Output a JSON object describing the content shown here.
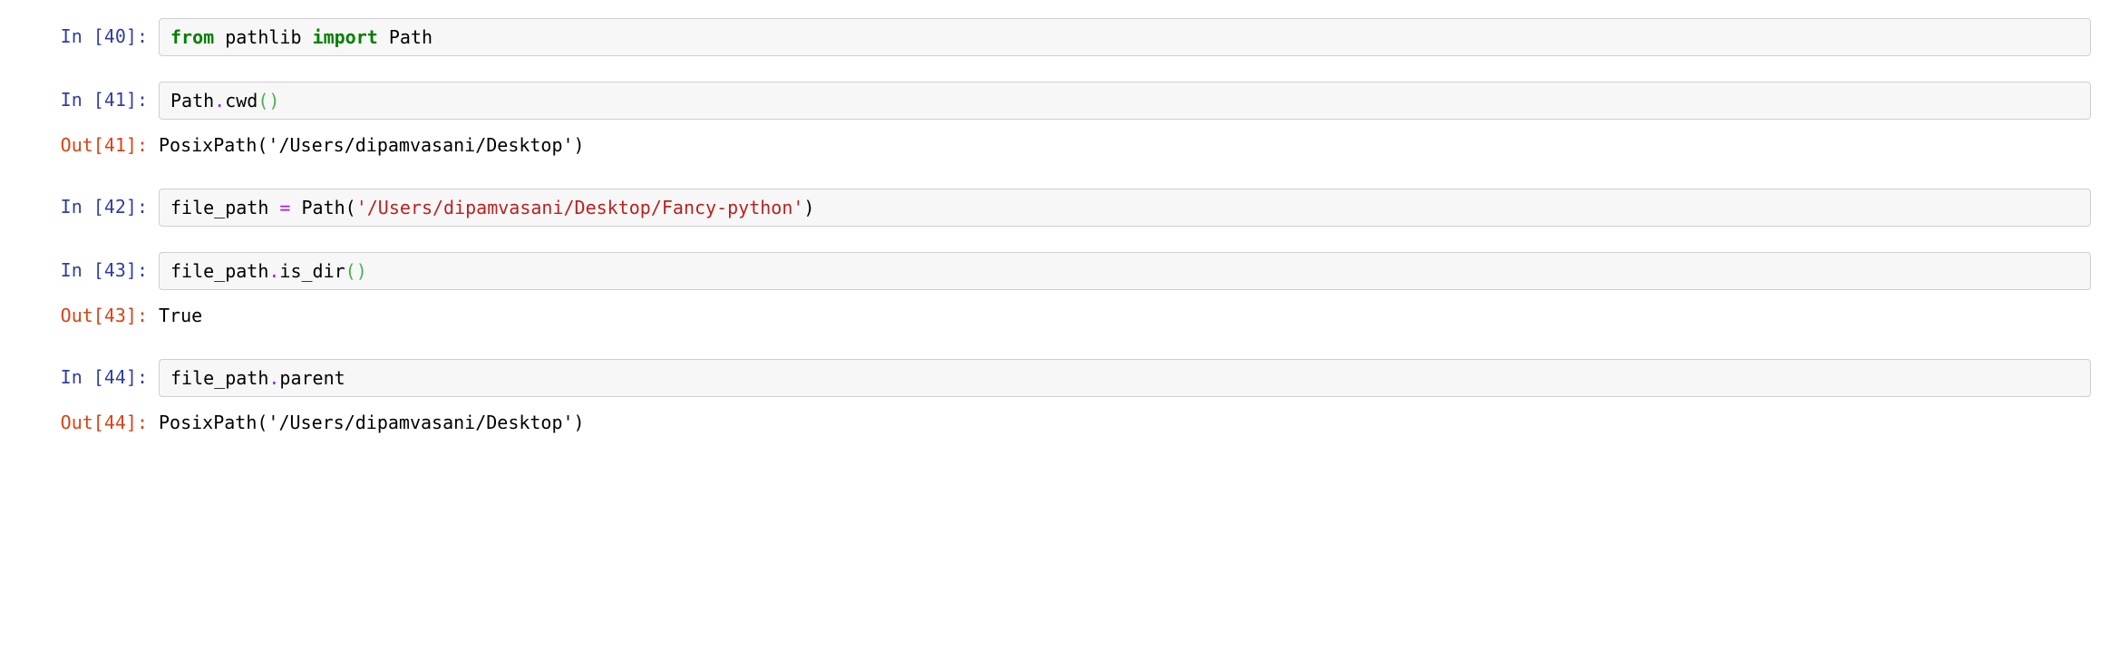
{
  "cells": [
    {
      "in_prompt": "In [40]:",
      "code": {
        "tokens": [
          {
            "cls": "kw-green",
            "text": "from"
          },
          {
            "cls": "plain",
            "text": " pathlib "
          },
          {
            "cls": "kw-green",
            "text": "import"
          },
          {
            "cls": "plain",
            "text": " Path"
          }
        ]
      }
    },
    {
      "in_prompt": "In [41]:",
      "code": {
        "tokens": [
          {
            "cls": "plain",
            "text": "Path"
          },
          {
            "cls": "op-purple",
            "text": "."
          },
          {
            "cls": "plain",
            "text": "cwd"
          },
          {
            "cls": "paren-green",
            "text": "()"
          }
        ]
      },
      "out_prompt": "Out[41]:",
      "output": "PosixPath('/Users/dipamvasani/Desktop')"
    },
    {
      "in_prompt": "In [42]:",
      "code": {
        "tokens": [
          {
            "cls": "plain",
            "text": "file_path "
          },
          {
            "cls": "op-purple",
            "text": "="
          },
          {
            "cls": "plain",
            "text": " Path("
          },
          {
            "cls": "string-red",
            "text": "'/Users/dipamvasani/Desktop/Fancy-python'"
          },
          {
            "cls": "plain",
            "text": ")"
          }
        ]
      }
    },
    {
      "in_prompt": "In [43]:",
      "code": {
        "tokens": [
          {
            "cls": "plain",
            "text": "file_path"
          },
          {
            "cls": "op-purple",
            "text": "."
          },
          {
            "cls": "plain",
            "text": "is_dir"
          },
          {
            "cls": "paren-green",
            "text": "()"
          }
        ]
      },
      "out_prompt": "Out[43]:",
      "output": "True"
    },
    {
      "in_prompt": "In [44]:",
      "code": {
        "tokens": [
          {
            "cls": "plain",
            "text": "file_path"
          },
          {
            "cls": "op-purple",
            "text": "."
          },
          {
            "cls": "plain",
            "text": "parent"
          }
        ]
      },
      "out_prompt": "Out[44]:",
      "output": "PosixPath('/Users/dipamvasani/Desktop')"
    }
  ]
}
